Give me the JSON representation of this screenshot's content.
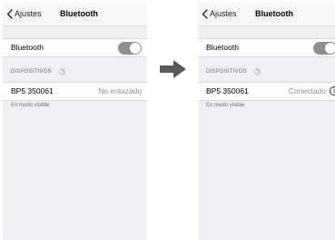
{
  "left": {
    "nav": {
      "back_label": "Ajustes",
      "title": "Bluetooth"
    },
    "bluetooth": {
      "label": "Bluetooth",
      "enabled": true
    },
    "devices": {
      "header": "DISPOSITIVOS",
      "name": "BP5 350061",
      "status": "No enlazado"
    },
    "footer": "En modo visible"
  },
  "right": {
    "nav": {
      "back_label": "Ajustes",
      "title": "Bluetooth"
    },
    "bluetooth": {
      "label": "Bluetooth",
      "enabled": true
    },
    "devices": {
      "header": "DISPOSITIVOS",
      "name": "BP5 350061",
      "status": "Conectado"
    },
    "info_glyph": "i",
    "footer": "En modo visible"
  },
  "icons": [
    "chevron-left-icon",
    "spinner-icon",
    "info-icon",
    "arrow-right-icon"
  ],
  "colors": {
    "toggle_on": "#8e8e93",
    "background": "#efeff4",
    "arrow": "#5a5a5a"
  }
}
